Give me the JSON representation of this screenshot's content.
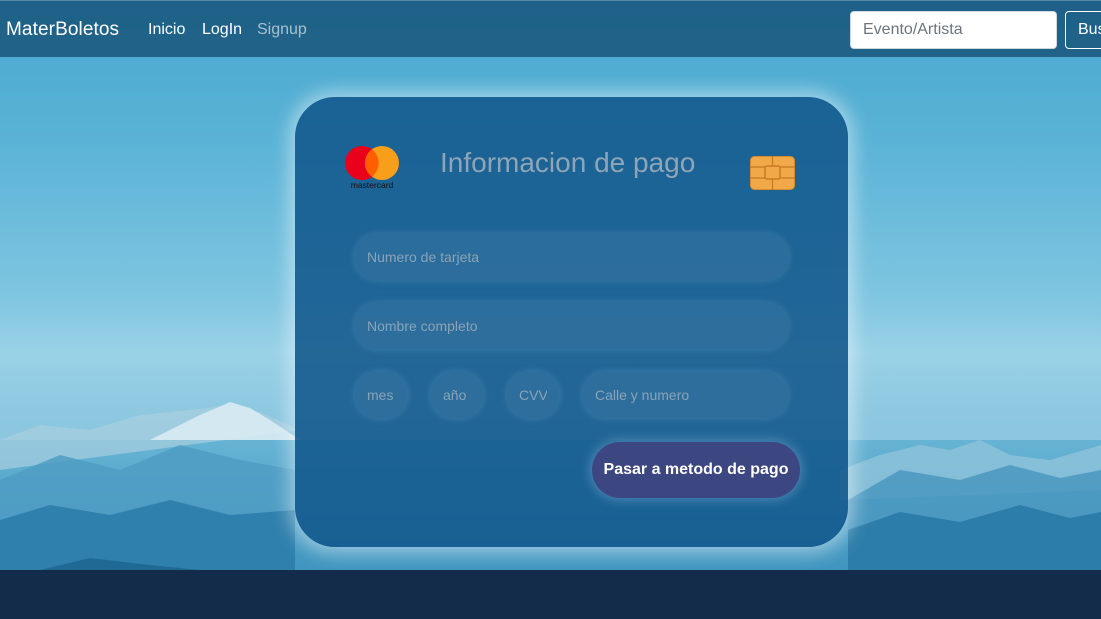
{
  "navbar": {
    "brand": "MaterBoletos",
    "links": [
      {
        "label": "Inicio"
      },
      {
        "label": "LogIn"
      },
      {
        "label": "Signup"
      }
    ],
    "search": {
      "placeholder": "Evento/Artista",
      "button_label": "Buscar"
    }
  },
  "card": {
    "logo_text": "mastercard",
    "title": "Informacion de pago",
    "fields": {
      "card_number": {
        "placeholder": "Numero de tarjeta"
      },
      "full_name": {
        "placeholder": "Nombre completo"
      },
      "month": {
        "placeholder": "mes"
      },
      "year": {
        "placeholder": "año"
      },
      "cvv": {
        "placeholder": "CVV"
      },
      "street": {
        "placeholder": "Calle y numero"
      }
    },
    "submit_label": "Pasar a metodo de pago"
  },
  "colors": {
    "navbar": "#165278",
    "card": "#12588c",
    "button": "#3c4680",
    "footer": "#132c4a",
    "mastercard_red": "#eb001b",
    "mastercard_orange": "#f79e1b",
    "chip": "#f0a848"
  },
  "icons": [
    "mastercard-logo",
    "card-chip-icon"
  ]
}
